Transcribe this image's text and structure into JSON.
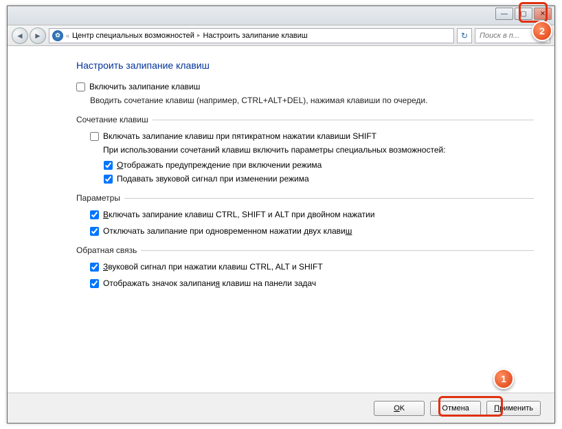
{
  "titlebar": {
    "minimize": "—",
    "maximize": "▢",
    "close": "✕"
  },
  "address": {
    "back": "◄",
    "forward": "►",
    "chevron": "«",
    "seg1": "Центр специальных возможностей",
    "seg2": "Настроить залипание клавиш",
    "refresh": "↻",
    "search_placeholder": "Поиск в п..."
  },
  "page": {
    "title": "Настроить залипание клавиш",
    "enable_label": "Включить залипание клавиш",
    "enable_desc": "Вводить сочетание клавиш (например, CTRL+ALT+DEL), нажимая клавиши по очереди."
  },
  "grp_shortcut": {
    "title": "Сочетание клавиш",
    "enable5x": "Включать залипание клавиш при пятикратном нажатии клавиши SHIFT",
    "use_desc": "При использовании сочетаний клавиш включить параметры специальных возможностей:",
    "warn": "тображать предупреждение при включении режима",
    "warn_key": "О",
    "sound": "Подавать звуковой сигнал при изменении режима"
  },
  "grp_params": {
    "title": "Параметры",
    "lock": "ключать запирание клавиш CTRL, SHIFT и ALT при двойном нажатии",
    "lock_key": "В",
    "off2": "Отключать залипание при одновременном нажатии двух клави",
    "off2_key": "ш"
  },
  "grp_feedback": {
    "title": "Обратная связь",
    "beep": "вуковой сигнал при нажатии клавиш CTRL, ALT и SHIFT",
    "beep_key": "З",
    "tray": "Отображать значок залипани",
    "tray_key": "я",
    "tray2": " клавиш на панели задач"
  },
  "footer": {
    "ok": "K",
    "ok_key": "O",
    "cancel": "Отмена",
    "apply": "рименить",
    "apply_key": "П"
  },
  "callouts": {
    "c1": "1",
    "c2": "2"
  }
}
